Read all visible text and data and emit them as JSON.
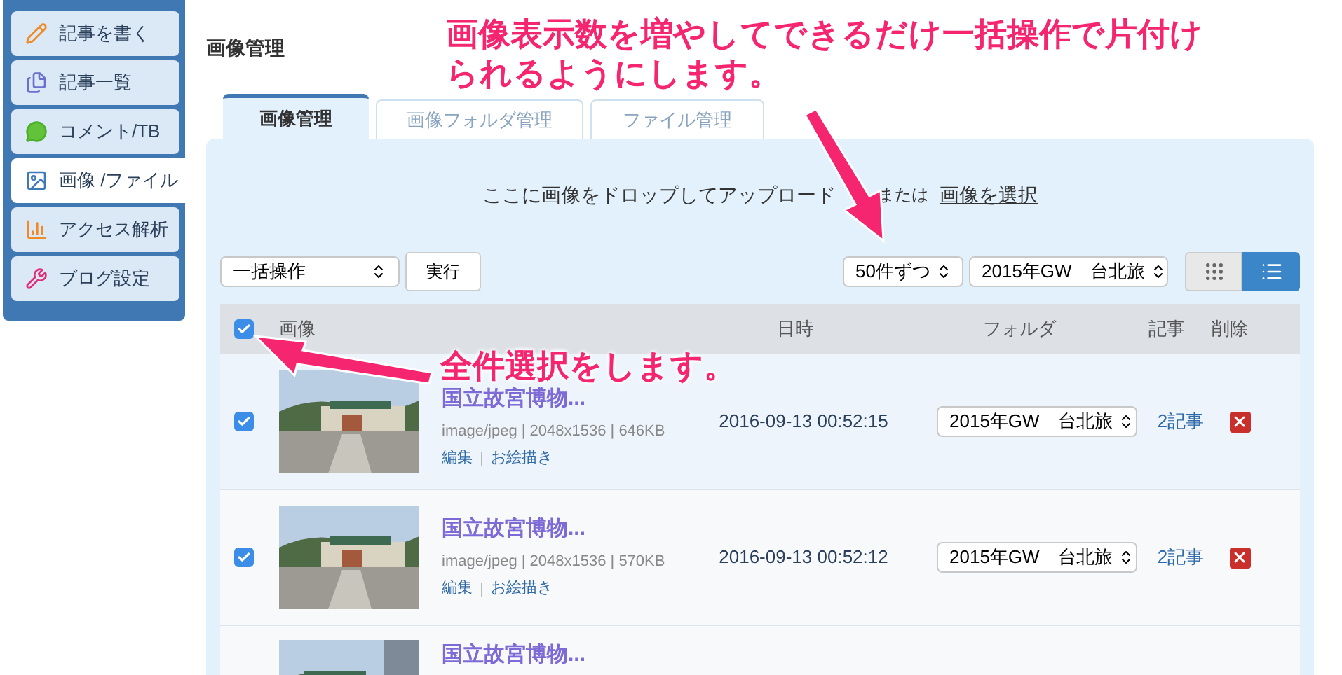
{
  "sidebar": {
    "items": [
      {
        "label": "記事を書く",
        "selected": false
      },
      {
        "label": "記事一覧",
        "selected": false
      },
      {
        "label": "コメント/TB",
        "selected": false
      },
      {
        "label": "画像 /ファイル",
        "selected": true
      },
      {
        "label": "アクセス解析",
        "selected": false
      },
      {
        "label": "ブログ設定",
        "selected": false
      }
    ]
  },
  "page_title": "画像管理",
  "tabs": [
    {
      "label": "画像管理",
      "selected": true
    },
    {
      "label": "画像フォルダ管理",
      "selected": false
    },
    {
      "label": "ファイル管理",
      "selected": false
    }
  ],
  "dropzone": {
    "text": "ここに画像をドロップしてアップロード",
    "or": "または",
    "link": "画像を選択"
  },
  "bulk_action": {
    "value": "一括操作",
    "button": "実行"
  },
  "per_page": {
    "value": "50件ずつ"
  },
  "folder_filter": {
    "value": "2015年GW　台北旅"
  },
  "view_toggle": [
    {
      "kind": "grid",
      "selected": false
    },
    {
      "kind": "list",
      "selected": true
    }
  ],
  "table": {
    "select_all_checked": true,
    "columns": [
      "画像",
      "日時",
      "フォルダ",
      "記事",
      "削除"
    ],
    "rows": [
      {
        "checked": true,
        "title": "国立故宮博物...",
        "meta": "image/jpeg | 2048x1536 | 646KB",
        "actions": [
          "編集",
          "お絵描き"
        ],
        "date": "2016-09-13 00:52:15",
        "folder": "2015年GW　台北旅",
        "articles": "2記事"
      },
      {
        "checked": true,
        "title": "国立故宮博物...",
        "meta": "image/jpeg | 2048x1536 | 570KB",
        "actions": [
          "編集",
          "お絵描き"
        ],
        "date": "2016-09-13 00:52:12",
        "folder": "2015年GW　台北旅",
        "articles": "2記事"
      },
      {
        "title": "国立故宮博物..."
      }
    ]
  },
  "annotations": [
    {
      "text": "画像表示数を増やしてできるだけ一括操作で片付けられるようにします。"
    },
    {
      "text": "全件選択をします。"
    }
  ]
}
